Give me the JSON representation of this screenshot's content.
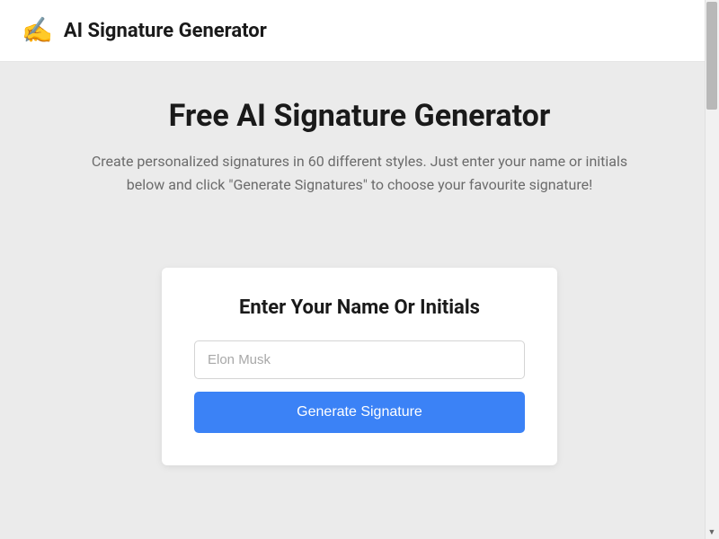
{
  "header": {
    "logo_emoji": "✍️",
    "brand_title": "AI Signature Generator"
  },
  "main": {
    "page_title": "Free AI Signature Generator",
    "page_subtitle": "Create personalized signatures in 60 different styles. Just enter your name or initials below and click \"Generate Signatures\" to choose your favourite signature!"
  },
  "card": {
    "title": "Enter Your Name Or Initials",
    "input_placeholder": "Elon Musk",
    "input_value": "",
    "button_label": "Generate Signature"
  }
}
